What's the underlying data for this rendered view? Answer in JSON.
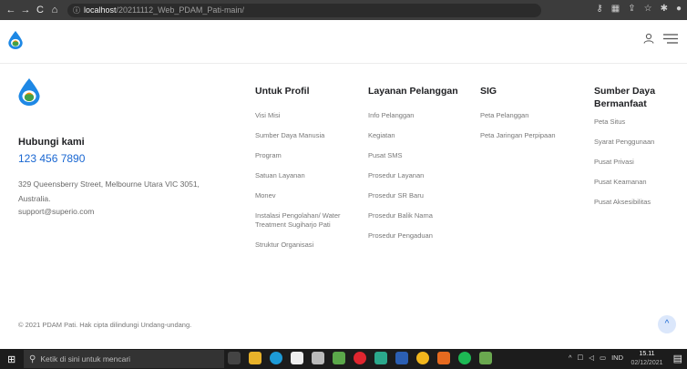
{
  "browser": {
    "back": "←",
    "forward": "→",
    "reload": "C",
    "home": "⌂",
    "info_icon": "ⓘ",
    "host": "localhost",
    "path": "/20211112_Web_PDAM_Pati-main/"
  },
  "footer": {
    "contact": {
      "title": "Hubungi kami",
      "phone": "123 456 7890",
      "address": "329 Queensberry Street, Melbourne Utara VIC 3051, Australia.",
      "email": "support@superio.com"
    },
    "columns": [
      {
        "title": "Untuk Profil",
        "items": [
          "Visi Misi",
          "Sumber Daya Manusia",
          "Program",
          "Satuan Layanan",
          "Monev",
          "Instalasi Pengolahan/ Water Treatment Sugiharjo Pati",
          "Struktur Organisasi"
        ]
      },
      {
        "title": "Layanan Pelanggan",
        "items": [
          "Info Pelanggan",
          "Kegiatan",
          "Pusat SMS",
          "Prosedur Layanan",
          "Prosedur SR Baru",
          "Prosedur Balik Nama",
          "Prosedur Pengaduan"
        ]
      },
      {
        "title": "SIG",
        "items": [
          "Peta Pelanggan",
          "Peta Jaringan Perpipaan"
        ]
      },
      {
        "title": "Sumber Daya Bermanfaat",
        "items": [
          "Peta Situs",
          "Syarat Penggunaan",
          "Pusat Privasi",
          "Pusat Keamanan",
          "Pusat Aksesibilitas"
        ]
      }
    ],
    "copyright": "© 2021 PDAM Pati. Hak cipta dilindungi Undang-undang.",
    "scroll_top": "^"
  },
  "taskbar": {
    "start": "⊞",
    "search_icon": "⚲",
    "search_placeholder": "Ketik di sini untuk mencari",
    "lang": "IND",
    "time": "15.11",
    "date": "02/12/2021"
  },
  "colors": {
    "accent": "#1967d2",
    "logo_blue": "#1e88e5",
    "logo_green": "#43a047",
    "logo_orange": "#fb8c00"
  }
}
